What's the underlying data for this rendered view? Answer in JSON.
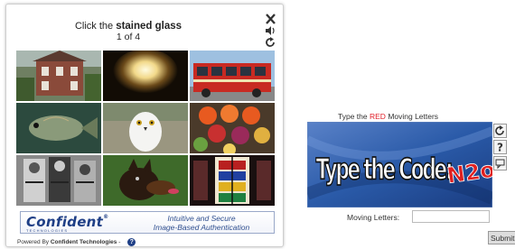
{
  "image_captcha": {
    "instruction_prefix": "Click the",
    "target": "stained glass",
    "progress": "1 of 4",
    "tools": [
      "close-icon",
      "audio-icon",
      "refresh-icon"
    ],
    "tiles": [
      "house",
      "lamp-glow",
      "red-bus",
      "fish",
      "owl",
      "fruit-platter",
      "stained-glass-figures",
      "dog",
      "stained-glass-window"
    ],
    "brand": {
      "logo": "Confident",
      "logo_sub": "TECHNOLOGIES",
      "tagline_line1": "Intuitive and Secure",
      "tagline_line2": "Image-Based Authentication"
    },
    "powered_prefix": "Powered By",
    "powered_company": "Confident Technologies",
    "powered_sep": "-",
    "help_glyph": "?"
  },
  "text_captcha": {
    "instr_prefix": "Type the",
    "instr_highlight": "RED",
    "instr_suffix": "Moving Letters",
    "code_text": "Type the Code:",
    "code_red": "N2o",
    "tools": [
      "refresh-icon",
      "help-icon",
      "comment-icon"
    ],
    "field_label": "Moving Letters:",
    "field_value": "",
    "submit_label": "Submit"
  }
}
